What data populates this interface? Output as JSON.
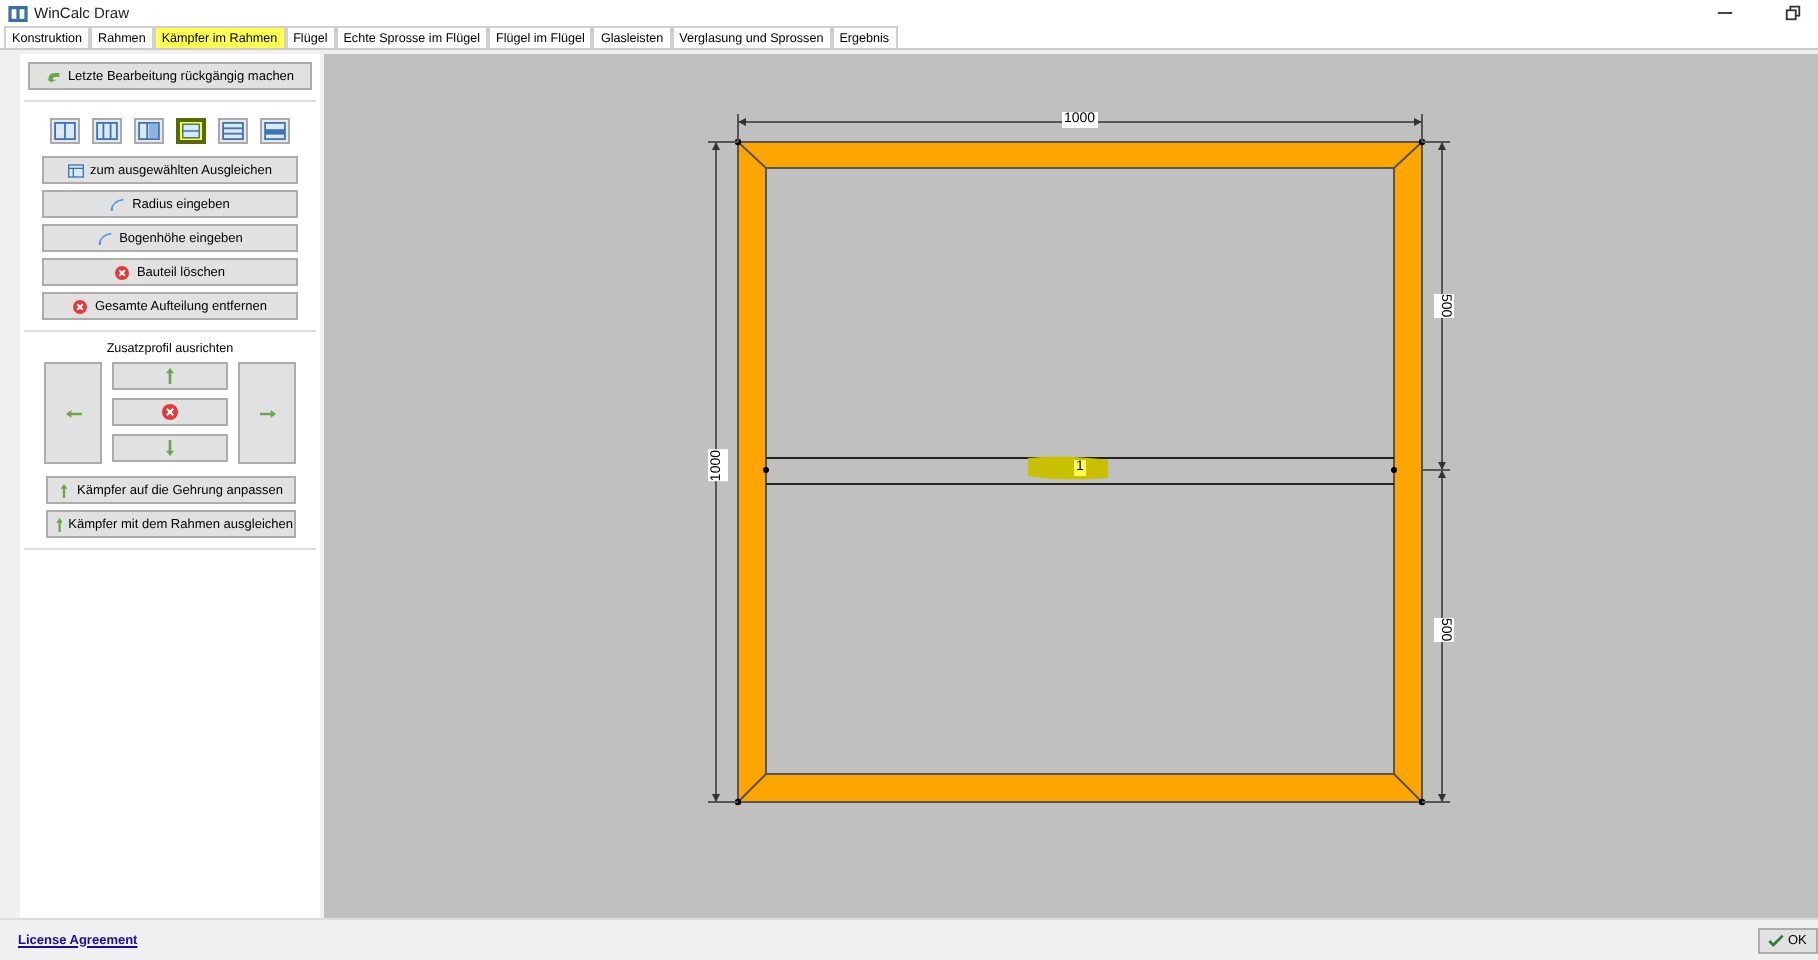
{
  "window": {
    "title": "WinCalc Draw"
  },
  "tabs": [
    {
      "label": "Konstruktion",
      "selected": false
    },
    {
      "label": "Rahmen",
      "selected": false
    },
    {
      "label": "Kämpfer im Rahmen",
      "selected": true
    },
    {
      "label": "Flügel",
      "selected": false
    },
    {
      "label": "Echte Sprosse im Flügel",
      "selected": false
    },
    {
      "label": "Flügel im Flügel",
      "selected": false
    },
    {
      "label": "Glasleisten",
      "selected": false
    },
    {
      "label": "Verglasung und Sprossen",
      "selected": false
    },
    {
      "label": "Ergebnis",
      "selected": false
    }
  ],
  "undo_button": "Letzte Bearbeitung rückgängig machen",
  "division_tools": [
    {
      "kind": "cols2",
      "selected": false
    },
    {
      "kind": "cols3",
      "selected": false
    },
    {
      "kind": "cols3b",
      "selected": false
    },
    {
      "kind": "rows2",
      "selected": true
    },
    {
      "kind": "rows3",
      "selected": false
    },
    {
      "kind": "rows3b",
      "selected": false
    }
  ],
  "actions": [
    {
      "kind": "grid",
      "label": "zum ausgewählten Ausgleichen"
    },
    {
      "kind": "arc",
      "label": "Radius eingeben"
    },
    {
      "kind": "arc",
      "label": "Bogenhöhe eingeben"
    },
    {
      "kind": "delete",
      "label": "Bauteil löschen"
    },
    {
      "kind": "delete",
      "label": "Gesamte Aufteilung entfernen"
    }
  ],
  "align_title": "Zusatzprofil ausrichten",
  "mullion_actions": [
    "Kämpfer auf die Gehrung anpassen",
    "Kämpfer mit dem Rahmen ausgleichen"
  ],
  "drawing": {
    "width_dim": "1000",
    "height_dim": "1000",
    "upper_dim": "500",
    "lower_dim": "500",
    "transom_label": "1"
  },
  "footer": {
    "link": "License Agreement",
    "ok": "OK"
  }
}
